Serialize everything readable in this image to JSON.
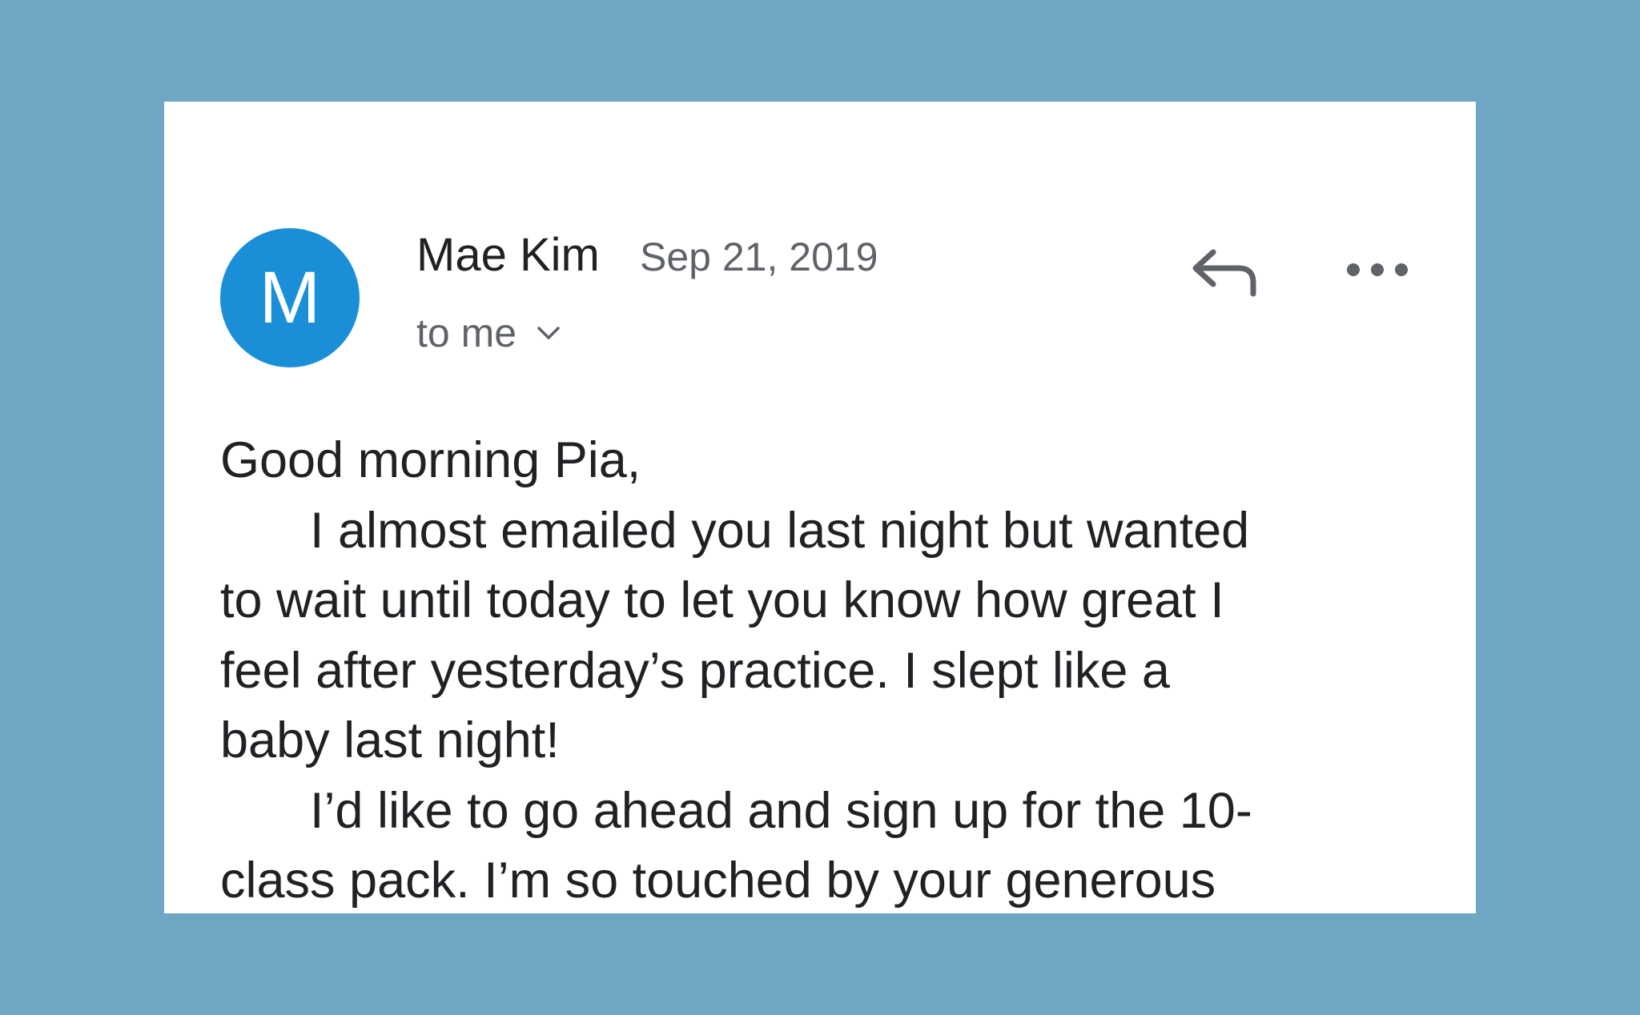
{
  "email": {
    "avatar_letter": "M",
    "sender_name": "Mae Kim",
    "date": "Sep 21, 2019",
    "recipient_label": "to me",
    "body_lines": [
      "Good morning Pia,",
      "I almost emailed you last night but wanted",
      "to wait until today to let you know how great I",
      "feel after yesterday’s practice. I slept like a",
      "baby last night!",
      "I’d like to go ahead and sign up for the 10-",
      "class pack. I’m so touched by your generous"
    ]
  },
  "icons": {
    "reply": "reply-icon",
    "more": "more-options-icon",
    "chevron": "chevron-down-icon"
  },
  "colors": {
    "background": "#6fa6c4",
    "card": "#ffffff",
    "avatar": "#1a8fd8",
    "primary_text": "#202124",
    "secondary_text": "#5f6368"
  }
}
